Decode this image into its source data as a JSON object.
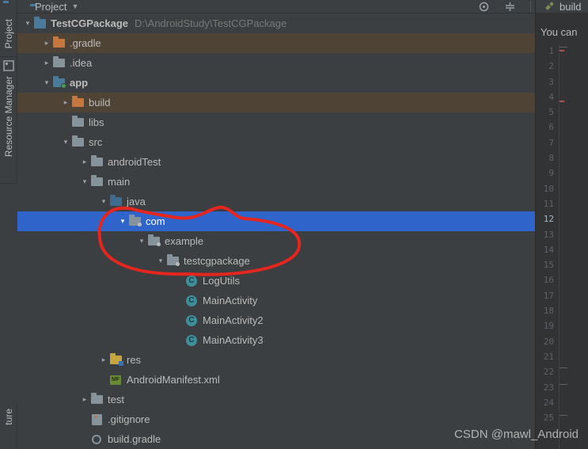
{
  "sidebar_tabs": {
    "project": "Project",
    "res_mgr": "Resource Manager",
    "truncated": "ture"
  },
  "topbar": {
    "title": "Project",
    "icons": {
      "target": "target-icon",
      "collapse": "collapse-all-icon",
      "divider": "divider",
      "gear": "gear-icon",
      "hide": "hide-icon"
    }
  },
  "editor_tab": {
    "label": "build"
  },
  "editor": {
    "header_text": "You can",
    "line_start": 1,
    "line_end": 25,
    "current_line": 12
  },
  "watermark": "CSDN @mawl_Android",
  "project": {
    "root": {
      "name": "TestCGPackage",
      "path": "D:\\AndroidStudy\\TestCGPackage"
    },
    "nodes": {
      "gradle_dir": ".gradle",
      "idea_dir": ".idea",
      "app": "app",
      "build": "build",
      "libs": "libs",
      "src": "src",
      "androidTest": "androidTest",
      "main": "main",
      "java": "java",
      "com": "com",
      "example": "example",
      "testcgpackage": "testcgpackage",
      "LogUtils": "LogUtils",
      "MainActivity": "MainActivity",
      "MainActivity2": "MainActivity2",
      "MainActivity3": "MainActivity3",
      "res": "res",
      "manifest": "AndroidManifest.xml",
      "test": "test",
      "gitignore": ".gitignore",
      "build_gradle": "build.gradle"
    }
  },
  "circle_letter": "C",
  "mf_letters": "MF"
}
